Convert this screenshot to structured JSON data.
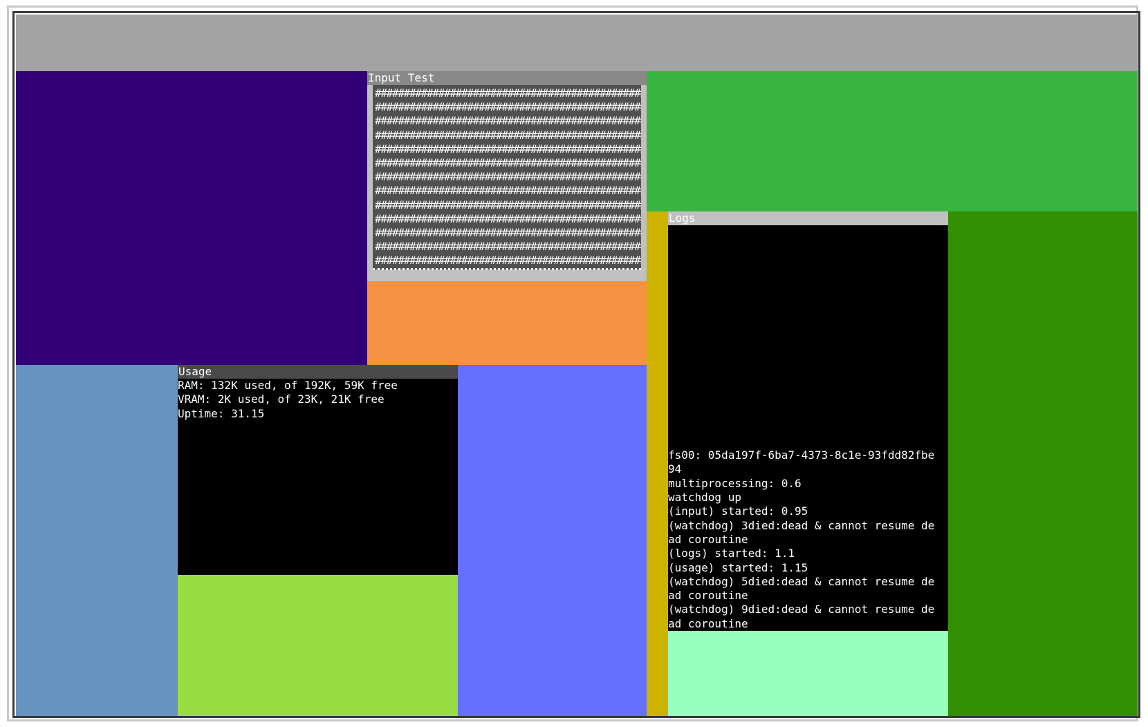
{
  "colors": {
    "top_bar": "#a3a3a3",
    "purple": "#330077",
    "green_top": "#39b441",
    "orange": "#f59241",
    "steel_blue": "#6693bf",
    "lime": "#99dd44",
    "periwinkle": "#6670ff",
    "mustard": "#ccb300",
    "dark_green": "#339002",
    "mint": "#99ffbf",
    "terminal_bg": "#000000",
    "usage_title": "#4a4a4a",
    "input_title": "#888888",
    "logs_title": "#c0c0c0"
  },
  "input_test": {
    "title": "Input Test",
    "row_text": "################################################",
    "row_count": 13
  },
  "usage": {
    "title": "Usage",
    "lines": [
      "RAM: 132K used, of 192K, 59K free",
      "VRAM: 2K used, of 23K, 21K free",
      "Uptime: 31.15"
    ]
  },
  "logs": {
    "title": "Logs",
    "lines": [
      "fs00: 05da197f-6ba7-4373-8c1e-93fdd82fbe",
      "94",
      "multiprocessing: 0.6",
      "watchdog up",
      "(input) started: 0.95",
      "(watchdog) 3died:dead & cannot resume de",
      "ad coroutine",
      "(logs) started: 1.1",
      "(usage) started: 1.15",
      "(watchdog) 5died:dead & cannot resume de",
      "ad coroutine",
      "(watchdog) 9died:dead & cannot resume de",
      "ad coroutine"
    ]
  }
}
